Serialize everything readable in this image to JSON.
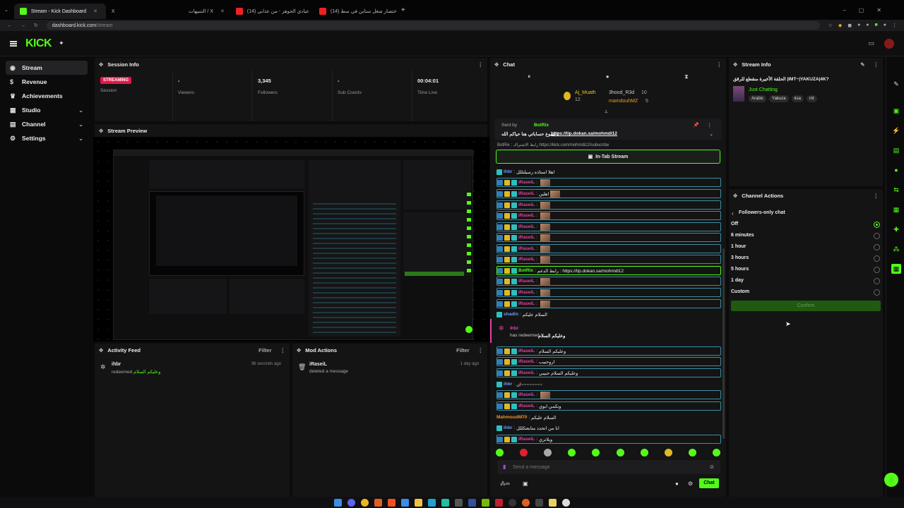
{
  "browser": {
    "tabs": [
      {
        "label": "Stream - Kick Dashboard",
        "active": true
      },
      {
        "label": "X"
      },
      {
        "label": "التنبيهات / X"
      },
      {
        "label": "(14) عيادي الجوهر - من عذابي"
      },
      {
        "label": "(14) اختصار شغل ستاين في سط"
      }
    ],
    "new_tab": "+",
    "url_host": "dashboard.kick.com",
    "url_path": "/stream"
  },
  "app": {
    "logo": "KICK",
    "sidebar": [
      {
        "label": "Stream",
        "icon": "broadcast-icon",
        "active": true
      },
      {
        "label": "Revenue",
        "icon": "dollar-icon"
      },
      {
        "label": "Achievements",
        "icon": "trophy-icon"
      },
      {
        "label": "Studio",
        "icon": "studio-icon",
        "chev": "⌄"
      },
      {
        "label": "Channel",
        "icon": "channel-icon",
        "chev": "⌄"
      },
      {
        "label": "Settings",
        "icon": "gear-icon",
        "chev": "⌄"
      }
    ]
  },
  "session": {
    "title": "Session Info",
    "badge": "STREAMING",
    "stats": [
      {
        "value": "",
        "label": "Session"
      },
      {
        "value": "-",
        "label": "Viewers"
      },
      {
        "value": "3,345",
        "label": "Followers"
      },
      {
        "value": "-",
        "label": "Sub Counts"
      },
      {
        "value": "00:04:01",
        "label": "Time Live"
      }
    ]
  },
  "preview": {
    "title": "Stream Preview"
  },
  "activity": {
    "title": "Activity Feed",
    "filter": "Filter",
    "item": {
      "user": "ihbr",
      "text": "redeemed",
      "reward": "وعليكم السلام",
      "time": "36 seconds ago"
    }
  },
  "mod": {
    "title": "Mod Actions",
    "filter": "Filter",
    "item": {
      "user": "iRaseiL",
      "text": "deleted a message",
      "time": "1 day ago"
    }
  },
  "chat": {
    "title": "Chat",
    "top_users": [
      {
        "name": "Aj_Muath",
        "count": "12"
      },
      {
        "name": "3hood_R3d",
        "count": "10"
      },
      {
        "name": "mamdouhMZ",
        "count": "5"
      }
    ],
    "pinned": {
      "sent_by": "Sent by",
      "user": "BotRix",
      "text": "جموع حساباتي هنا حياكم الله :",
      "link": "https://tip.dokan.sa/mohmdi12"
    },
    "partial_line": "BotRix : رابط الاشتراك https://kick.com/mohmdi12/subscribe",
    "in_tab": "In-Tab Stream",
    "messages": [
      {
        "user": "ihbr",
        "text": "اهلا استاذه رسيلتللل",
        "cls": "b",
        "boxed": false
      },
      {
        "user": "iRaseiL",
        "text": "",
        "thumb": true,
        "boxed": true
      },
      {
        "user": "iRaseiL",
        "text": "اهلين",
        "thumb": true,
        "boxed": true
      },
      {
        "user": "iRaseiL",
        "text": "",
        "thumb": true,
        "boxed": true
      },
      {
        "user": "iRaseiL",
        "text": "",
        "thumb": true,
        "boxed": true
      },
      {
        "user": "iRaseiL",
        "text": "",
        "thumb": true,
        "boxed": true
      },
      {
        "user": "iRaseiL",
        "text": "",
        "thumb": true,
        "boxed": true
      },
      {
        "user": "iRaseiL",
        "text": "",
        "thumb": true,
        "boxed": true
      },
      {
        "user": "iRaseiL",
        "text": "",
        "thumb": true,
        "boxed": true
      },
      {
        "user": "BotRix",
        "text": "رابط الدعم : https://tip.dokan.sa/mohmdi12",
        "cls": "g",
        "boxed": true
      },
      {
        "user": "iRaseiL",
        "text": "",
        "thumb": true,
        "boxed": true
      },
      {
        "user": "iRaseiL",
        "text": "",
        "thumb": true,
        "boxed": true
      },
      {
        "user": "iRaseiL",
        "text": "",
        "thumb": true,
        "boxed": true
      },
      {
        "user": "shadin",
        "text": "السلام عليكم",
        "cls": "b",
        "boxed": false
      }
    ],
    "redeem": {
      "user": "ihbr",
      "text": "has redeemed",
      "reward": "وعليكم السلام"
    },
    "messages2": [
      {
        "user": "iRaseiL",
        "text": "وعليكم السلام",
        "boxed": true
      },
      {
        "user": "iRaseiL",
        "text": "اروحبيب",
        "boxed": true
      },
      {
        "user": "iRaseiL",
        "text": "وعليكم السلام حبيبي",
        "boxed": true
      },
      {
        "user": "ihbr",
        "text": "ان~~~~~~~~",
        "cls": "b",
        "boxed": false
      },
      {
        "user": "iRaseiL",
        "text": "",
        "thumb": true,
        "boxed": true
      },
      {
        "user": "iRaseiL",
        "text": "ونكمي ابوي",
        "boxed": true
      },
      {
        "user": "MahmoudM70",
        "text": "السلام عليكم",
        "cls": "o",
        "boxed": false
      },
      {
        "user": "ihbr",
        "text": "انا من اتحدد متابعتكللل",
        "cls": "b",
        "boxed": false
      },
      {
        "user": "iRaseiL",
        "text": "ويلاتري",
        "boxed": true
      }
    ],
    "placeholder": "Send a message",
    "send": "Chat"
  },
  "stream_info": {
    "title": "Stream Info",
    "stream_title": "الحلقة الأخيرة منقطع للرقق |IMT~|YAKUZA|4K?",
    "category": "Just Chatting",
    "tags": [
      "Arabic",
      "Yakuza",
      "ksa",
      "mt"
    ]
  },
  "channel_actions": {
    "title": "Channel Actions",
    "subtitle": "Followers-only chat",
    "options": [
      "Off",
      "6 minutes",
      "1 hour",
      "3 hours",
      "5 hours",
      "1 day",
      "Custom"
    ],
    "selected": "Off",
    "confirm": "Confirm"
  },
  "colors": {
    "accent": "#53fc18",
    "live": "#e5164a",
    "panel": "#141415"
  }
}
